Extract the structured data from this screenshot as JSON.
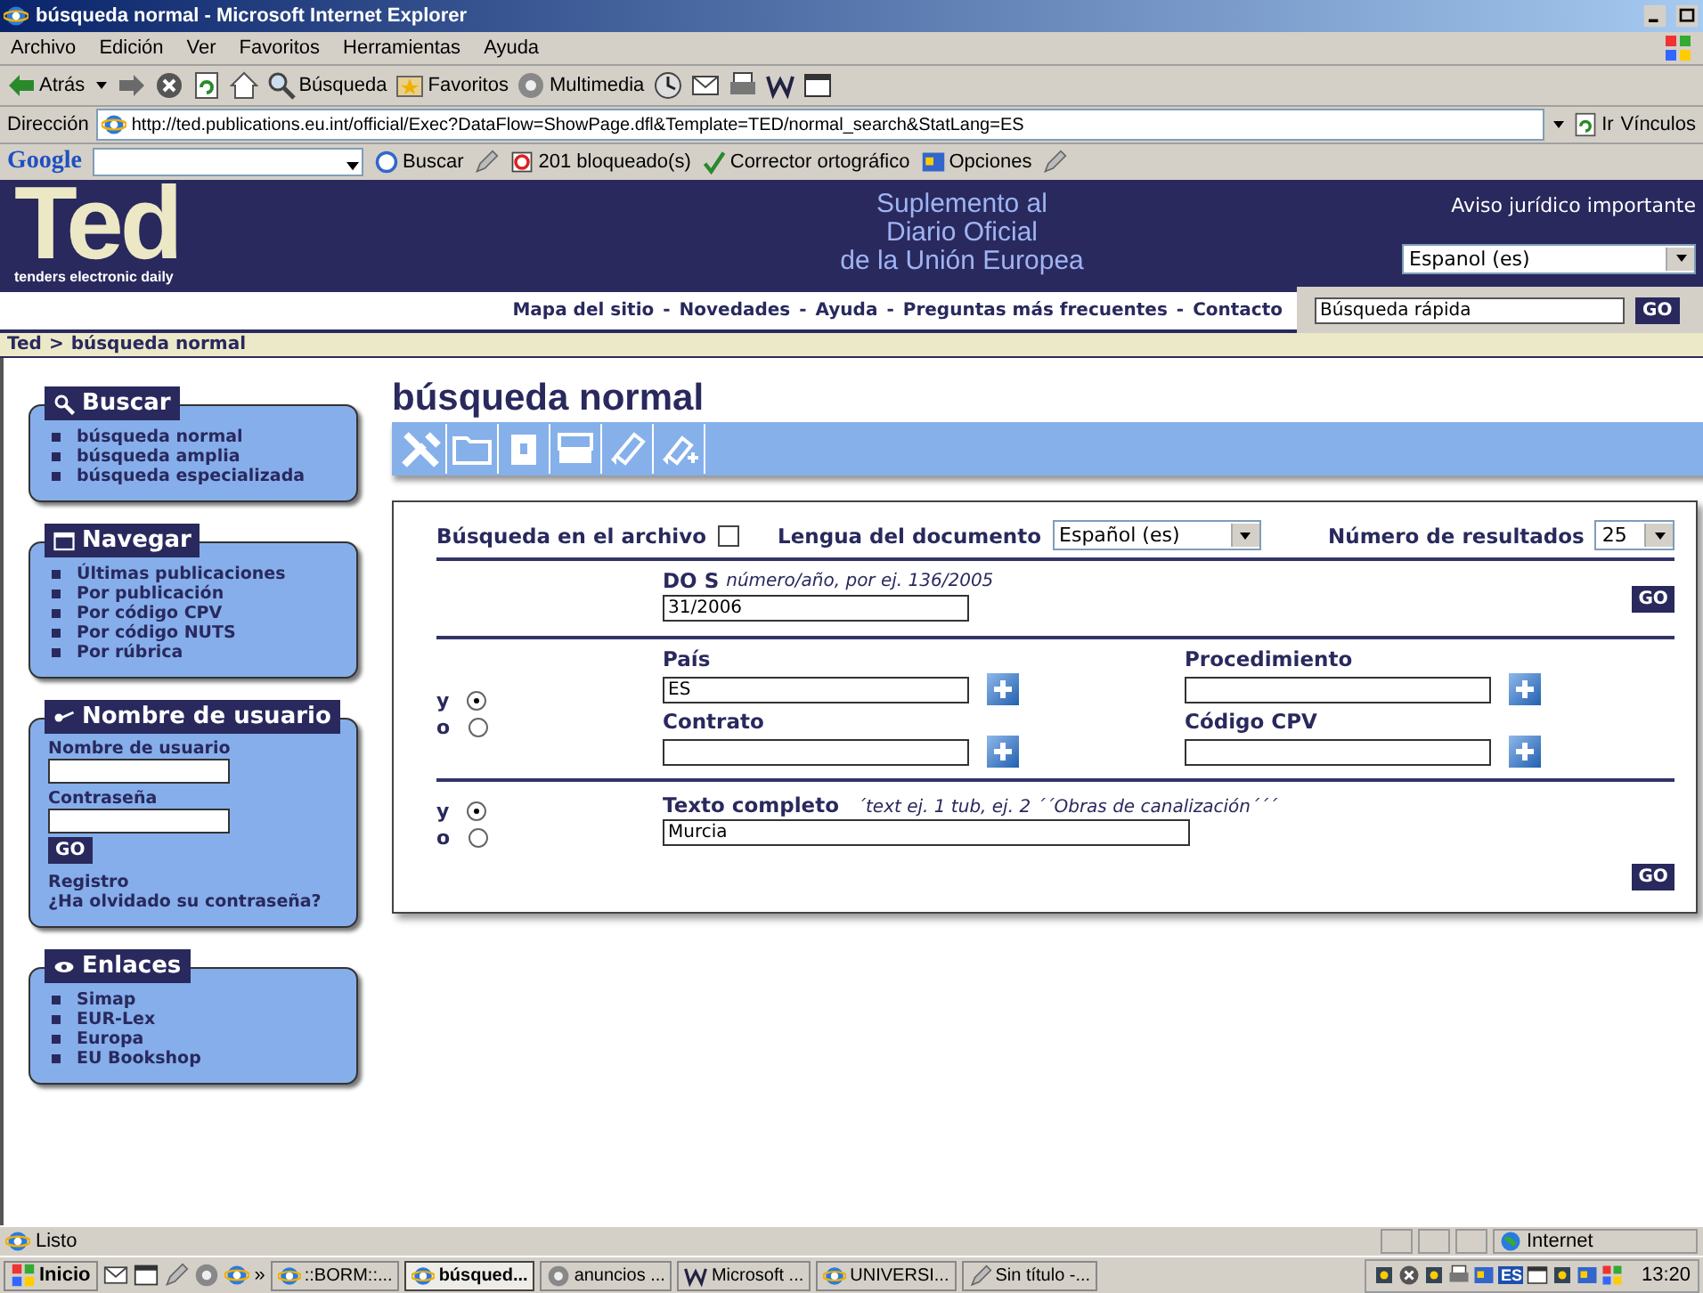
{
  "window": {
    "title": "búsqueda normal - Microsoft Internet Explorer"
  },
  "menu": [
    "Archivo",
    "Edición",
    "Ver",
    "Favoritos",
    "Herramientas",
    "Ayuda"
  ],
  "toolbar": [
    {
      "kind": "back",
      "label": "Atrás"
    },
    {
      "kind": "forward"
    },
    {
      "kind": "stop"
    },
    {
      "kind": "refresh"
    },
    {
      "kind": "home"
    },
    {
      "kind": "search",
      "label": "Búsqueda"
    },
    {
      "kind": "favorites",
      "label": "Favoritos"
    },
    {
      "kind": "media",
      "label": "Multimedia"
    },
    {
      "kind": "history"
    },
    {
      "kind": "mail"
    },
    {
      "kind": "print"
    },
    {
      "kind": "word"
    },
    {
      "kind": "window"
    }
  ],
  "address": {
    "label": "Dirección",
    "url": "http://ted.publications.eu.int/official/Exec?DataFlow=ShowPage.dfl&Template=TED/normal_search&StatLang=ES",
    "go": "Ir",
    "links": "Vínculos"
  },
  "google_toolbar": {
    "logo": "Google",
    "search": "Buscar",
    "blocked": "201 bloqueado(s)",
    "spell": "Corrector ortográfico",
    "options": "Opciones"
  },
  "site_header": {
    "logo": "Ted",
    "tagline": "tenders electronic daily",
    "title_lines": [
      "Suplemento al",
      "Diario Oficial",
      "de la Unión Europea"
    ],
    "legal": "Aviso jurídico importante",
    "language": "Espanol (es)"
  },
  "nav": {
    "links": [
      "Mapa del sitio",
      "Novedades",
      "Ayuda",
      "Preguntas más frecuentes",
      "Contacto"
    ],
    "separator": "-",
    "quick_search": "Búsqueda rápida",
    "button": "GO"
  },
  "breadcrumb": {
    "items": [
      "Ted",
      "búsqueda normal"
    ],
    "separator": ">"
  },
  "sidebar": [
    {
      "kind": "links",
      "title": "Buscar",
      "items": [
        "búsqueda normal",
        "búsqueda amplia",
        "búsqueda especializada"
      ]
    },
    {
      "kind": "links",
      "title": "Navegar",
      "items": [
        "Últimas publicaciones",
        "Por publicación",
        "Por código CPV",
        "Por código NUTS",
        "Por rúbrica"
      ]
    },
    {
      "kind": "login",
      "title": "Nombre de usuario",
      "user_label": "Nombre de usuario",
      "password_label": "Contraseña",
      "button": "GO",
      "links": [
        "Registro",
        "¿Ha olvidado su contraseña?"
      ]
    },
    {
      "kind": "links",
      "title": "Enlaces",
      "items": [
        "Simap",
        "EUR-Lex",
        "Europa",
        "EU Bookshop"
      ]
    }
  ],
  "main": {
    "heading": "búsqueda normal",
    "archive": {
      "label": "Búsqueda en el archivo",
      "checked": false
    },
    "language": {
      "label": "Lengua del documento",
      "value": "Español (es)"
    },
    "results": {
      "label": "Número de resultados",
      "value": "25"
    },
    "doc": {
      "label": "DO S",
      "hint": "número/año, por ej. 136/2005",
      "value": "31/2006",
      "button": "GO"
    },
    "criteria": {
      "operators": [
        {
          "label": "y",
          "selected": true
        },
        {
          "label": "o",
          "selected": false
        }
      ],
      "fields": [
        {
          "label": "País",
          "value": "ES"
        },
        {
          "label": "Procedimiento"
        },
        {
          "label": "Contrato"
        },
        {
          "label": "Código CPV"
        }
      ]
    },
    "fulltext": {
      "operators": [
        {
          "label": "y",
          "selected": true
        },
        {
          "label": "o",
          "selected": false
        }
      ],
      "label": "Texto completo",
      "hint": "´text ej. 1 tub, ej. 2 ´´Obras de canalización´´´",
      "value": "Murcia",
      "button": "GO"
    }
  },
  "status_bar": {
    "text": "Listo",
    "zone": "Internet"
  },
  "taskbar": {
    "start": "Inicio",
    "more": "»",
    "tasks": [
      {
        "label": "::BORM::...",
        "selected": false
      },
      {
        "label": "búsqued...",
        "selected": true
      },
      {
        "label": "anuncios ...",
        "selected": false
      },
      {
        "label": "Microsoft ...",
        "selected": false
      },
      {
        "label": "UNIVERSI...",
        "selected": false
      },
      {
        "label": "Sin título -...",
        "selected": false
      }
    ],
    "language": "ES",
    "clock": "13:20"
  }
}
